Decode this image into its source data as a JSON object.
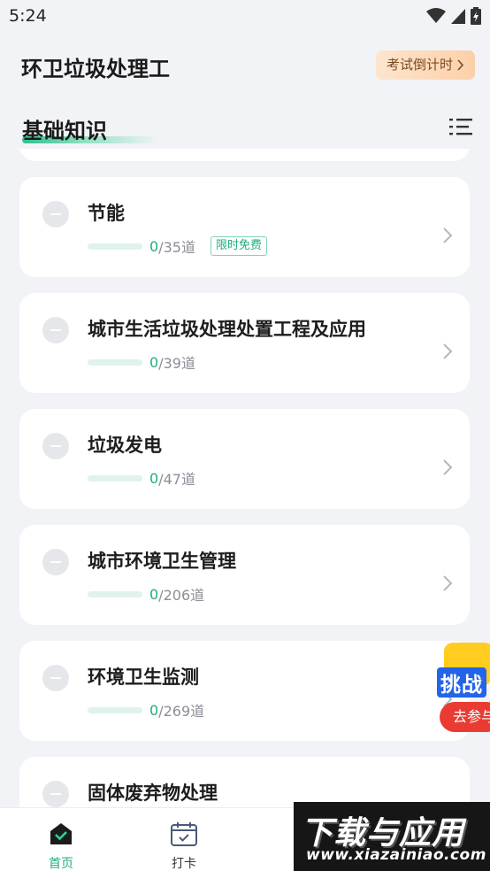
{
  "status_bar": {
    "time": "5:24"
  },
  "header": {
    "title": "环卫垃圾处理工",
    "countdown_label": "考试倒计时"
  },
  "section": {
    "title": "基础知识"
  },
  "items": [
    {
      "name": "节能",
      "done": "0",
      "total": "/35道",
      "tag": "限时免费"
    },
    {
      "name": "城市生活垃圾处理处置工程及应用",
      "done": "0",
      "total": "/39道"
    },
    {
      "name": "垃圾发电",
      "done": "0",
      "total": "/47道"
    },
    {
      "name": "城市环境卫生管理",
      "done": "0",
      "total": "/206道"
    },
    {
      "name": "环境卫生监测",
      "done": "0",
      "total": "/269道"
    },
    {
      "name": "固体废弃物处理"
    }
  ],
  "challenge": {
    "title": "挑战",
    "action": "去参与"
  },
  "tabbar": {
    "home": "首页",
    "checkin": "打卡"
  },
  "watermark": {
    "main": "下载与应用",
    "url": "www.xiazainiao.com"
  },
  "colors": {
    "accent": "#1fae7c",
    "background": "#f2f3f7",
    "card": "#ffffff",
    "countdown_bg": "#fbd9b8",
    "challenge_red": "#ea3b33"
  }
}
